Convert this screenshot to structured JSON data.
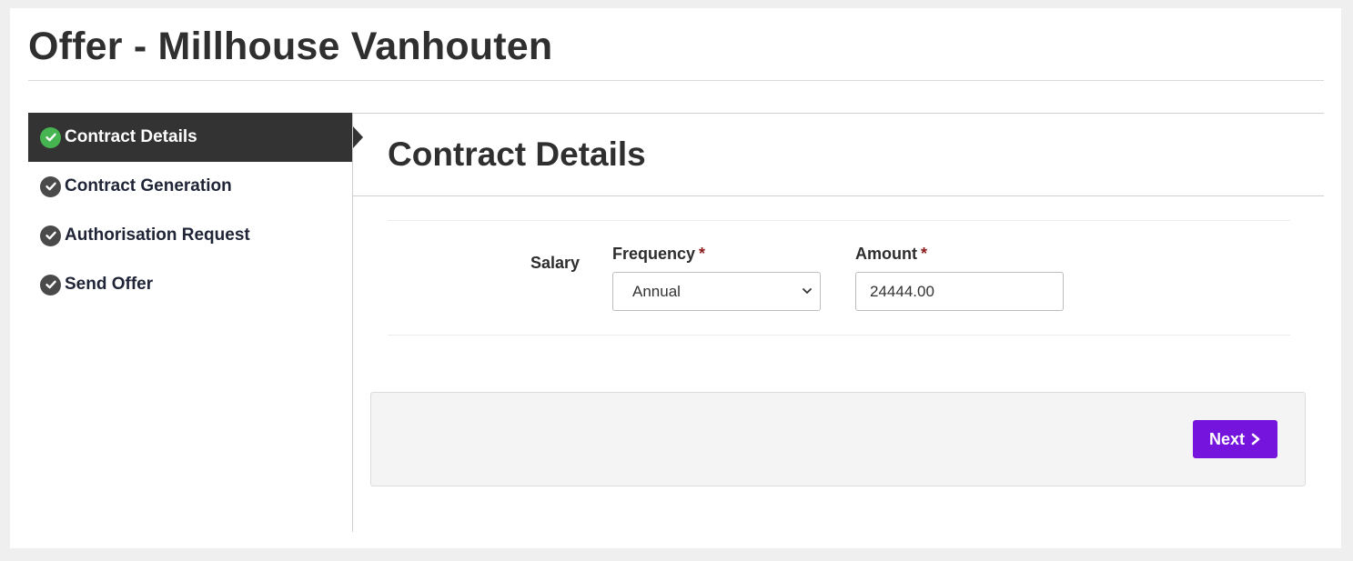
{
  "page": {
    "title": "Offer - Millhouse Vanhouten"
  },
  "sidebar": {
    "items": [
      {
        "label": "Contract Details",
        "icon": "check-circle-icon",
        "active": true,
        "status_color": "#46b450"
      },
      {
        "label": "Contract Generation",
        "icon": "check-circle-icon",
        "active": false
      },
      {
        "label": "Authorisation Request",
        "icon": "check-circle-icon",
        "active": false
      },
      {
        "label": "Send Offer",
        "icon": "check-circle-icon",
        "active": false
      }
    ]
  },
  "main": {
    "section_title": "Contract Details",
    "salary": {
      "label": "Salary",
      "frequency": {
        "label": "Frequency",
        "required_marker": "*",
        "value": "Annual"
      },
      "amount": {
        "label": "Amount",
        "required_marker": "*",
        "value": "24444.00"
      }
    }
  },
  "footer": {
    "next_label": "Next",
    "next_icon": "chevron-right-icon",
    "accent_color": "#7414dc"
  }
}
